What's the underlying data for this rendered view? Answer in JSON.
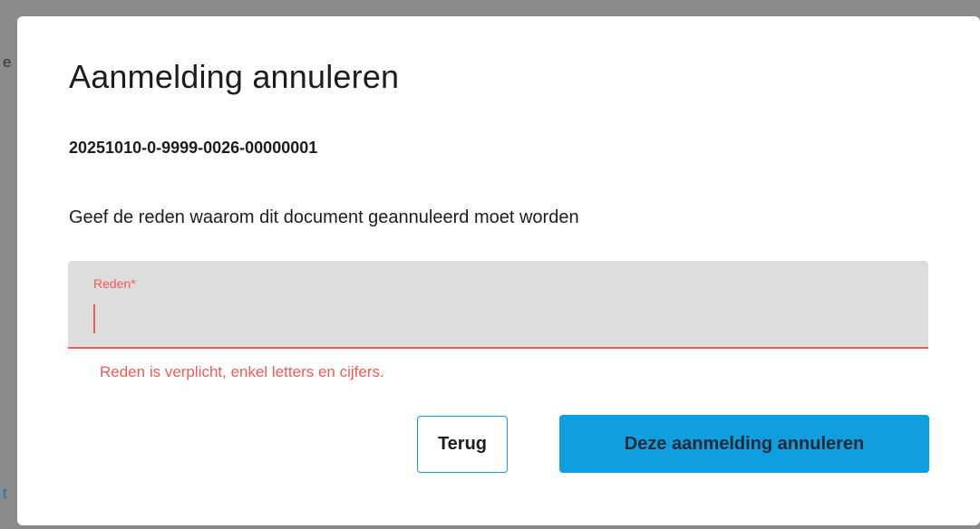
{
  "background": {
    "fragment_top": "e",
    "fragment_bottom": "t"
  },
  "dialog": {
    "title": "Aanmelding annuleren",
    "document_number": "20251010-0-9999-0026-00000001",
    "instruction": "Geef de reden waarom dit document geannuleerd moet worden",
    "reason_field": {
      "label": "Reden*",
      "value": "",
      "error": "Reden is verplicht, enkel letters en cijfers."
    },
    "buttons": {
      "back_label": "Terug",
      "confirm_label": "Deze aanmelding annuleren"
    }
  },
  "colors": {
    "accent": "#0f9ee0",
    "error": "#f05b55",
    "field_background": "#dddddd",
    "backdrop": "#8a8a8a"
  }
}
